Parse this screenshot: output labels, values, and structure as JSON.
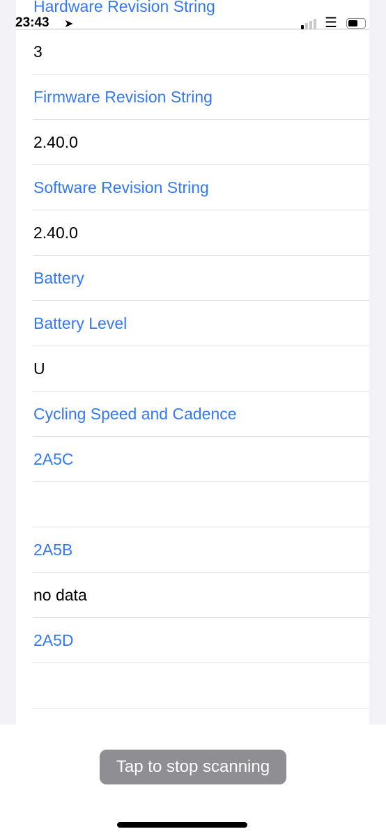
{
  "status_bar": {
    "time": "23:43",
    "location_icon": "location-arrow-icon",
    "signal_icon": "cellular-signal-icon",
    "wifi_icon": "wifi-icon",
    "battery_icon": "battery-icon"
  },
  "rows": [
    {
      "text": "Hardware Revision String",
      "type": "link"
    },
    {
      "text": "3",
      "type": "value"
    },
    {
      "text": "Firmware Revision String",
      "type": "link"
    },
    {
      "text": "2.40.0",
      "type": "value"
    },
    {
      "text": "Software Revision String",
      "type": "link"
    },
    {
      "text": "2.40.0",
      "type": "value"
    },
    {
      "text": "Battery",
      "type": "link"
    },
    {
      "text": "Battery Level",
      "type": "link"
    },
    {
      "text": "U",
      "type": "value"
    },
    {
      "text": "Cycling Speed and Cadence",
      "type": "link"
    },
    {
      "text": "2A5C",
      "type": "link"
    },
    {
      "text": "",
      "type": "value"
    },
    {
      "text": "2A5B",
      "type": "link"
    },
    {
      "text": "no data",
      "type": "value"
    },
    {
      "text": "2A5D",
      "type": "link"
    },
    {
      "text": "",
      "type": "value"
    }
  ],
  "scan_button": "Tap to stop scanning",
  "colors": {
    "link": "#3478f6",
    "background": "#f2f2f7",
    "button": "#8e8e93"
  }
}
